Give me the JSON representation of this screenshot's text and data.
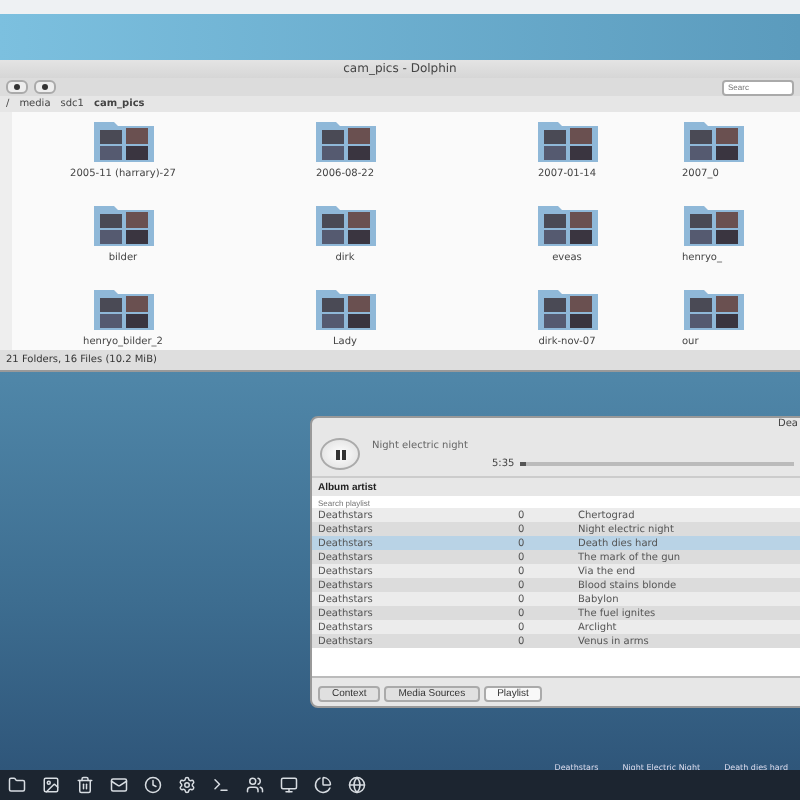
{
  "file_manager": {
    "title": "cam_pics - Dolphin",
    "search": {
      "placeholder": "Searc"
    },
    "breadcrumb": [
      "/",
      "media",
      "sdc1",
      "cam_pics"
    ],
    "folders": [
      {
        "name": "2005-11 (harrary)-27"
      },
      {
        "name": "2006-08-22"
      },
      {
        "name": "2007-01-14"
      },
      {
        "name": "2007_0"
      },
      {
        "name": "bilder"
      },
      {
        "name": "dirk"
      },
      {
        "name": "eveas"
      },
      {
        "name": "henryo_"
      },
      {
        "name": "henryo_bilder_2"
      },
      {
        "name": "Lady"
      },
      {
        "name": "dirk-nov-07"
      },
      {
        "name": "our"
      }
    ],
    "status": "21 Folders, 16 Files (10.2 MiB)"
  },
  "player": {
    "title": "Dea",
    "now_playing": "Night electric night",
    "time": "5:35",
    "progress": {
      "level": 0.02
    },
    "sort": "Album artist",
    "search": {
      "placeholder": "Search playlist"
    },
    "tracks": [
      {
        "artist": "Deathstars",
        "number": "0",
        "title": "Chertograd",
        "selected": false
      },
      {
        "artist": "Deathstars",
        "number": "0",
        "title": "Night electric night",
        "selected": false
      },
      {
        "artist": "Deathstars",
        "number": "0",
        "title": "Death dies hard",
        "selected": true
      },
      {
        "artist": "Deathstars",
        "number": "0",
        "title": "The mark of the gun",
        "selected": false
      },
      {
        "artist": "Deathstars",
        "number": "0",
        "title": "Via the end",
        "selected": false
      },
      {
        "artist": "Deathstars",
        "number": "0",
        "title": "Blood stains blonde",
        "selected": false
      },
      {
        "artist": "Deathstars",
        "number": "0",
        "title": "Babylon",
        "selected": false
      },
      {
        "artist": "Deathstars",
        "number": "0",
        "title": "The fuel ignites",
        "selected": false
      },
      {
        "artist": "Deathstars",
        "number": "0",
        "title": "Arclight",
        "selected": false
      },
      {
        "artist": "Deathstars",
        "number": "0",
        "title": "Venus in arms",
        "selected": false
      }
    ],
    "tabs": [
      {
        "label": "Context",
        "selected": false
      },
      {
        "label": "Media Sources",
        "selected": false
      },
      {
        "label": "Playlist",
        "selected": true
      }
    ]
  },
  "tray": [
    "Deathstars",
    "Night Electric Night",
    "Death dies hard"
  ]
}
